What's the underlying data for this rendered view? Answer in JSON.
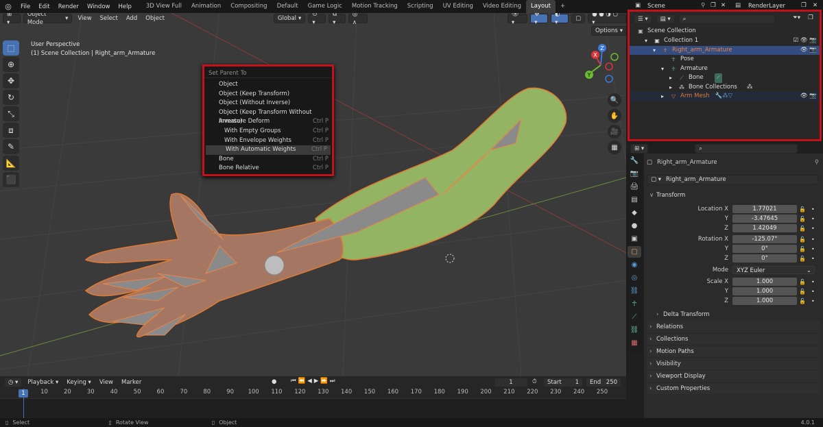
{
  "topbar": {
    "menus": [
      "File",
      "Edit",
      "Render",
      "Window",
      "Help"
    ],
    "workspaces": [
      "3D View Full",
      "Animation",
      "Compositing",
      "Default",
      "Game Logic",
      "Motion Tracking",
      "Scripting",
      "UV Editing",
      "Video Editing",
      "Layout"
    ],
    "active_workspace": "Layout",
    "scene": "Scene",
    "view_layer": "RenderLayer"
  },
  "viewport": {
    "mode": "Object Mode",
    "menus": [
      "View",
      "Select",
      "Add",
      "Object"
    ],
    "orientation": "Global",
    "options": "Options",
    "info_line1": "User Perspective",
    "info_line2": "(1) Scene Collection | Right_arm_Armature",
    "gizmo_axes": [
      "X",
      "Y",
      "Z"
    ]
  },
  "parent_menu": {
    "title": "Set Parent To",
    "items": [
      {
        "label": "Object",
        "shortcut": ""
      },
      {
        "label": "Object (Keep Transform)",
        "shortcut": ""
      },
      {
        "label": "Object (Without Inverse)",
        "shortcut": ""
      },
      {
        "label": "Object (Keep Transform Without Inverse)",
        "shortcut": ""
      },
      {
        "label": "Armature Deform",
        "shortcut": "Ctrl P"
      },
      {
        "label": "With Empty Groups",
        "shortcut": "Ctrl P"
      },
      {
        "label": "With Envelope Weights",
        "shortcut": "Ctrl P"
      },
      {
        "label": "With Automatic Weights",
        "shortcut": "Ctrl P"
      },
      {
        "label": "Bone",
        "shortcut": "Ctrl P"
      },
      {
        "label": "Bone Relative",
        "shortcut": "Ctrl P"
      }
    ],
    "highlighted_index": 7
  },
  "timeline": {
    "menus": [
      "Playback",
      "Keying",
      "View",
      "Marker"
    ],
    "current_frame": "1",
    "start_label": "Start",
    "start": "1",
    "end_label": "End",
    "end": "250",
    "ruler": [
      "1",
      "10",
      "20",
      "30",
      "40",
      "50",
      "60",
      "70",
      "80",
      "90",
      "100",
      "110",
      "120",
      "130",
      "140",
      "150",
      "160",
      "170",
      "180",
      "190",
      "200",
      "210",
      "220",
      "230",
      "240",
      "250"
    ]
  },
  "statusbar": {
    "select": "Select",
    "rotate": "Rotate View",
    "object": "Object",
    "version": "4.0.1"
  },
  "outliner": {
    "rows": [
      {
        "label": "Scene Collection",
        "depth": 0
      },
      {
        "label": "Collection 1",
        "depth": 1
      },
      {
        "label": "Right_arm_Armature",
        "depth": 2
      },
      {
        "label": "Pose",
        "depth": 3
      },
      {
        "label": "Armature",
        "depth": 3
      },
      {
        "label": "Bone",
        "depth": 4
      },
      {
        "label": "Bone Collections",
        "depth": 4
      },
      {
        "label": "Arm Mesh",
        "depth": 2
      }
    ]
  },
  "properties": {
    "object_name": "Right_arm_Armature",
    "data_name": "Right_arm_Armature",
    "transform_label": "Transform",
    "location_label": "Location X",
    "location": [
      "1.77021",
      "-3.47645",
      "1.42049"
    ],
    "rotation_label": "Rotation X",
    "rotation": [
      "-125.07°",
      "0°",
      "0°"
    ],
    "axis_y": "Y",
    "axis_z": "Z",
    "mode_label": "Mode",
    "mode": "XYZ Euler",
    "scale_label": "Scale X",
    "scale": [
      "1.000",
      "1.000",
      "1.000"
    ],
    "delta": "Delta Transform",
    "sections": [
      "Relations",
      "Collections",
      "Motion Paths",
      "Visibility",
      "Viewport Display",
      "Custom Properties"
    ]
  },
  "colors": {
    "accent": "#4772b3",
    "highlight_border": "#c4121a",
    "selected_row": "#334d80",
    "armature_orange": "#e8844a",
    "mesh_orange": "#e07a32"
  }
}
